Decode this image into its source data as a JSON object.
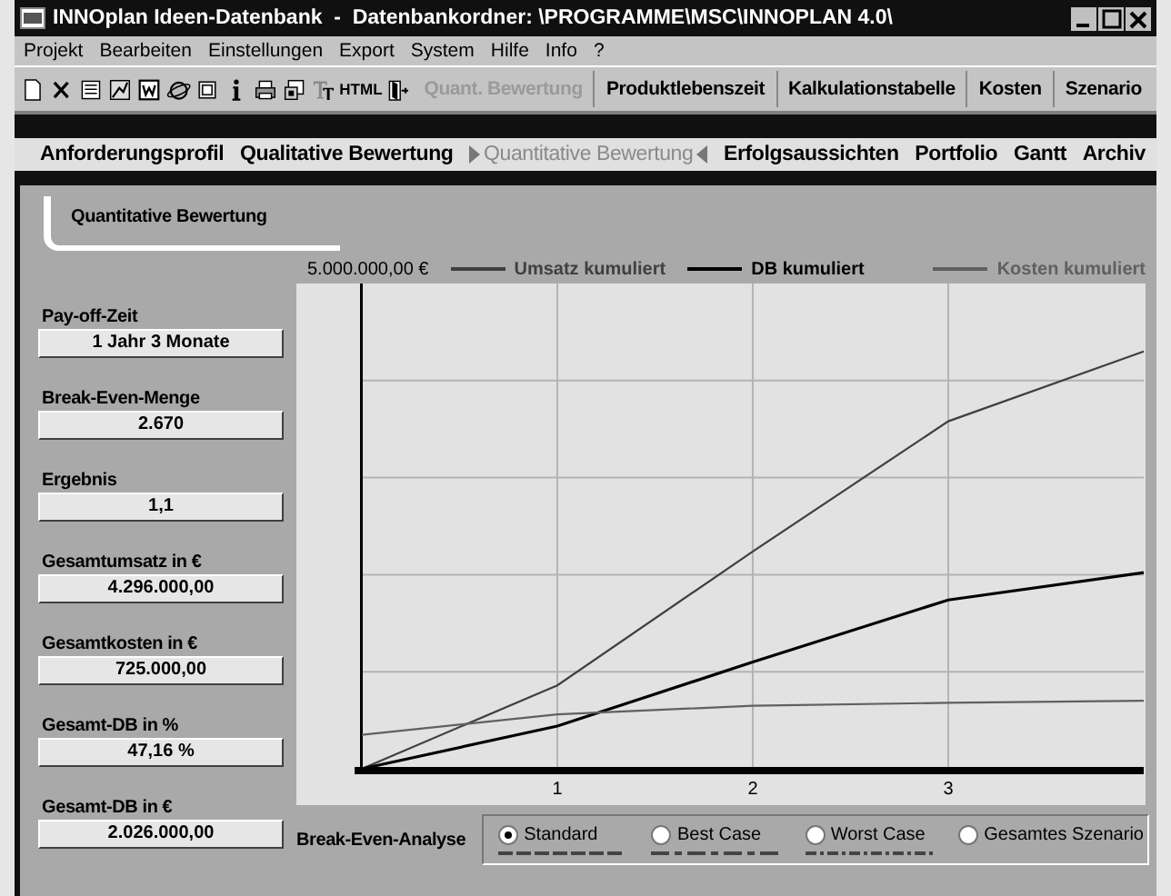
{
  "window": {
    "title": "INNOplan Ideen-Datenbank  -  Datenbankordner: \\PROGRAMME\\MSC\\INNOPLAN 4.0\\"
  },
  "menu": [
    "Projekt",
    "Bearbeiten",
    "Einstellungen",
    "Export",
    "System",
    "Hilfe",
    "Info",
    "?"
  ],
  "toolbar": {
    "icons": [
      {
        "kind": "new"
      },
      {
        "kind": "delete"
      },
      {
        "kind": "list"
      },
      {
        "kind": "chart"
      },
      {
        "kind": "word"
      },
      {
        "kind": "browser"
      },
      {
        "kind": "clock"
      },
      {
        "kind": "info"
      },
      {
        "kind": "print"
      },
      {
        "kind": "settings"
      },
      {
        "kind": "font"
      },
      {
        "kind": "html",
        "label": "HTML"
      },
      {
        "kind": "exit"
      }
    ],
    "buttons": [
      {
        "label": "Quant. Bewertung",
        "disabled": true
      },
      {
        "label": "Produktlebenszeit",
        "disabled": false
      },
      {
        "label": "Kalkulationstabelle",
        "disabled": false
      },
      {
        "label": "Kosten",
        "disabled": false
      },
      {
        "label": "Szenario",
        "disabled": false
      }
    ]
  },
  "tabs": [
    {
      "label": "Anforderungsprofil",
      "selected": false
    },
    {
      "label": "Qualitative Bewertung",
      "selected": false
    },
    {
      "label": "Quantitative Bewertung",
      "selected": true
    },
    {
      "label": "Erfolgsaussichten",
      "selected": false
    },
    {
      "label": "Portfolio",
      "selected": false
    },
    {
      "label": "Gantt",
      "selected": false
    },
    {
      "label": "Archiv",
      "selected": false
    }
  ],
  "panel": {
    "title": "Quantitative Bewertung",
    "fields": [
      {
        "label": "Pay-off-Zeit",
        "value": "1 Jahr 3 Monate"
      },
      {
        "label": "Break-Even-Menge",
        "value": "2.670"
      },
      {
        "label": "Ergebnis",
        "value": "1,1"
      },
      {
        "label": "Gesamtumsatz in €",
        "value": "4.296.000,00"
      },
      {
        "label": "Gesamtkosten in €",
        "value": "725.000,00"
      },
      {
        "label": "Gesamt-DB in %",
        "value": "47,16 %"
      },
      {
        "label": "Gesamt-DB in €",
        "value": "2.026.000,00"
      }
    ],
    "chart": {
      "scale_label": "5.000.000,00 €",
      "x_labels": [
        "1",
        "2",
        "3"
      ],
      "legend": [
        {
          "name": "Umsatz kumuliert",
          "color": "#404040"
        },
        {
          "name": "DB kumuliert",
          "color": "#000000"
        },
        {
          "name": "Kosten kumuliert",
          "color": "#606060"
        }
      ]
    },
    "analysis": {
      "label": "Break-Even-Analyse",
      "options": [
        {
          "label": "Standard",
          "selected": true
        },
        {
          "label": "Best Case",
          "selected": false
        },
        {
          "label": "Worst Case",
          "selected": false
        },
        {
          "label": "Gesamtes Szenario",
          "selected": false
        }
      ]
    }
  }
}
